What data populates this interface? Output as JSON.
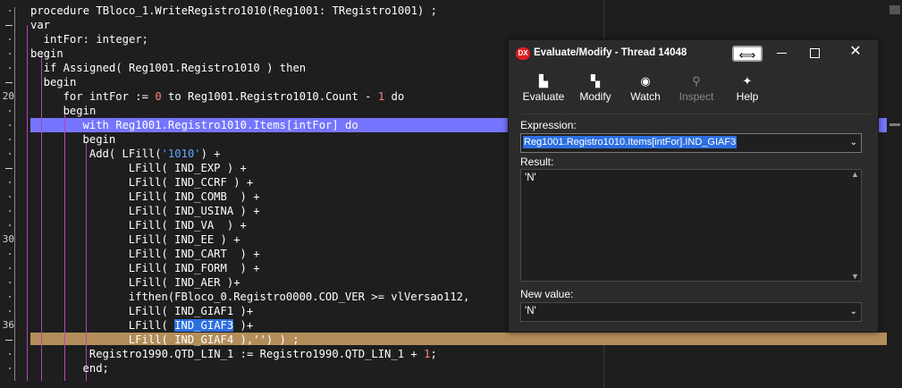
{
  "editor": {
    "lines": [
      {
        "indent": 0,
        "parts": [
          {
            "t": "procedure TBloco_1.WriteRegistro1010(Reg1001: TRegistro1001) ;"
          }
        ]
      },
      {
        "indent": 0,
        "parts": [
          {
            "t": "var"
          }
        ]
      },
      {
        "indent": 2,
        "parts": [
          {
            "t": "intFor: integer;"
          }
        ]
      },
      {
        "indent": 0,
        "parts": [
          {
            "t": "begin"
          }
        ]
      },
      {
        "indent": 2,
        "parts": [
          {
            "t": "if Assigned( Reg1001.Registro1010 ) then"
          }
        ]
      },
      {
        "indent": 2,
        "parts": [
          {
            "t": "begin"
          }
        ]
      },
      {
        "indent": 5,
        "parts": [
          {
            "t": "for intFor := "
          },
          {
            "t": "0",
            "c": "num"
          },
          {
            "t": " to Reg1001.Registro1010.Count - "
          },
          {
            "t": "1",
            "c": "num"
          },
          {
            "t": " do"
          }
        ]
      },
      {
        "indent": 5,
        "parts": [
          {
            "t": "begin"
          }
        ]
      },
      {
        "indent": 8,
        "parts": [
          {
            "t": "with Reg1001.Registro1010.Items[intFor] do"
          }
        ]
      },
      {
        "indent": 8,
        "parts": [
          {
            "t": "begin"
          }
        ]
      },
      {
        "indent": 9,
        "parts": [
          {
            "t": "Add( LFill("
          },
          {
            "t": "'1010'",
            "c": "str"
          },
          {
            "t": ") +"
          }
        ]
      },
      {
        "indent": 15,
        "parts": [
          {
            "t": "LFill( IND_EXP ) +"
          }
        ]
      },
      {
        "indent": 15,
        "parts": [
          {
            "t": "LFill( IND_CCRF ) +"
          }
        ]
      },
      {
        "indent": 15,
        "parts": [
          {
            "t": "LFill( IND_COMB  ) +"
          }
        ]
      },
      {
        "indent": 15,
        "parts": [
          {
            "t": "LFill( IND_USINA ) +"
          }
        ]
      },
      {
        "indent": 15,
        "parts": [
          {
            "t": "LFill( IND_VA  ) +"
          }
        ]
      },
      {
        "indent": 15,
        "parts": [
          {
            "t": "LFill( IND_EE ) +"
          }
        ]
      },
      {
        "indent": 15,
        "parts": [
          {
            "t": "LFill( IND_CART  ) +"
          }
        ]
      },
      {
        "indent": 15,
        "parts": [
          {
            "t": "LFill( IND_FORM  ) +"
          }
        ]
      },
      {
        "indent": 15,
        "parts": [
          {
            "t": "LFill( IND_AER )+"
          }
        ]
      },
      {
        "indent": 15,
        "parts": [
          {
            "t": "ifthen(FBloco_0.Registro0000.COD_VER >= vlVersao112,"
          }
        ]
      },
      {
        "indent": 15,
        "parts": [
          {
            "t": "LFill( IND_GIAF1 )+"
          }
        ]
      },
      {
        "indent": 15,
        "parts": [
          {
            "t": "LFill( "
          },
          {
            "t": "IND_GIAF3",
            "c": "sel"
          },
          {
            "t": " )+"
          }
        ]
      },
      {
        "indent": 15,
        "parts": [
          {
            "t": "LFill( IND_GIAF4 ),'') ) ;"
          }
        ]
      },
      {
        "indent": 9,
        "parts": [
          {
            "t": "Registro1990.QTD_LIN_1 := Registro1990.QTD_LIN_1 + "
          },
          {
            "t": "1",
            "c": "num"
          },
          {
            "t": ";"
          }
        ]
      },
      {
        "indent": 8,
        "parts": [
          {
            "t": "end;"
          }
        ]
      }
    ],
    "gutter_numbers": [
      {
        "row": 6,
        "text": "20"
      },
      {
        "row": 16,
        "text": "30"
      },
      {
        "row": 22,
        "text": "36"
      }
    ]
  },
  "dialog": {
    "logo": "DX",
    "title": "Evaluate/Modify - Thread 14048",
    "pin_glyph": "⟺",
    "close_glyph": "✕",
    "toolbar": [
      {
        "id": "evaluate",
        "label": "Evaluate",
        "icon": "evaluate-icon",
        "glyph": "▙",
        "enabled": true
      },
      {
        "id": "modify",
        "label": "Modify",
        "icon": "modify-icon",
        "glyph": "▚",
        "enabled": true
      },
      {
        "id": "watch",
        "label": "Watch",
        "icon": "watch-icon",
        "glyph": "◉",
        "enabled": true
      },
      {
        "id": "inspect",
        "label": "Inspect",
        "icon": "inspect-icon",
        "glyph": "⚲",
        "enabled": false
      },
      {
        "id": "help",
        "label": "Help",
        "icon": "help-icon",
        "glyph": "✦",
        "enabled": true
      }
    ],
    "expression_label": "Expression:",
    "expression_value": "Reg1001.Registro1010.Items[intFor].IND_GIAF3",
    "result_label": "Result:",
    "result_value": "'N'",
    "new_value_label": "New value:",
    "new_value": "'N'",
    "combo_arrow": "⌄"
  },
  "colors": {
    "exec_line": "#7575ff",
    "breakpoint_line": "#b38e5a",
    "selection": "#2d6fe0",
    "guide": "#b347b3"
  }
}
